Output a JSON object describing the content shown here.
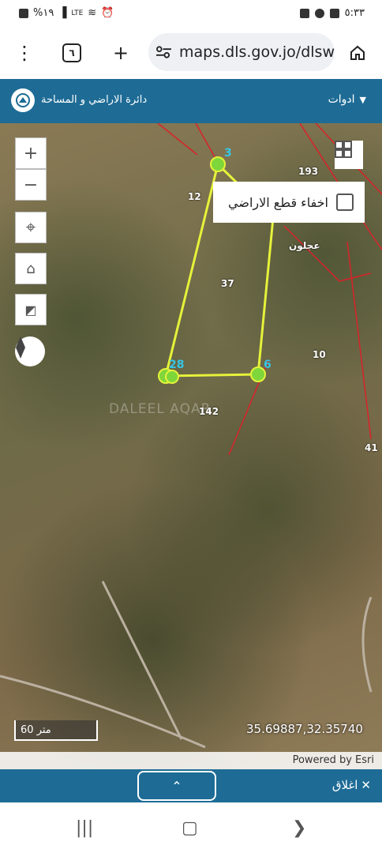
{
  "status_bar": {
    "time": "٥:٣٣",
    "battery": "%١٩",
    "network": "LTE"
  },
  "browser": {
    "tab_count": "٦",
    "url": "maps.dls.gov.jo/dlsw"
  },
  "header": {
    "title": "دائرة الاراضي و المساحة",
    "tools_label": "ادوات"
  },
  "map": {
    "hide_parcels_label": "اخفاء قطع الاراضي",
    "parcel_numbers": [
      "193",
      "12",
      "37",
      "10",
      "142",
      "41"
    ],
    "point_labels": [
      "3",
      "28",
      "6"
    ],
    "place_label": "عجلون",
    "watermark": "DALEEL AQAR",
    "scale": "60 متر",
    "coordinates": "35.69887,32.35740",
    "attribution": "Powered by Esri"
  },
  "footer": {
    "close_label": "اغلاق"
  },
  "colors": {
    "header_bg": "#1e6c96",
    "boundary": "#e6f23a",
    "parcel_lines": "#d8232a"
  }
}
